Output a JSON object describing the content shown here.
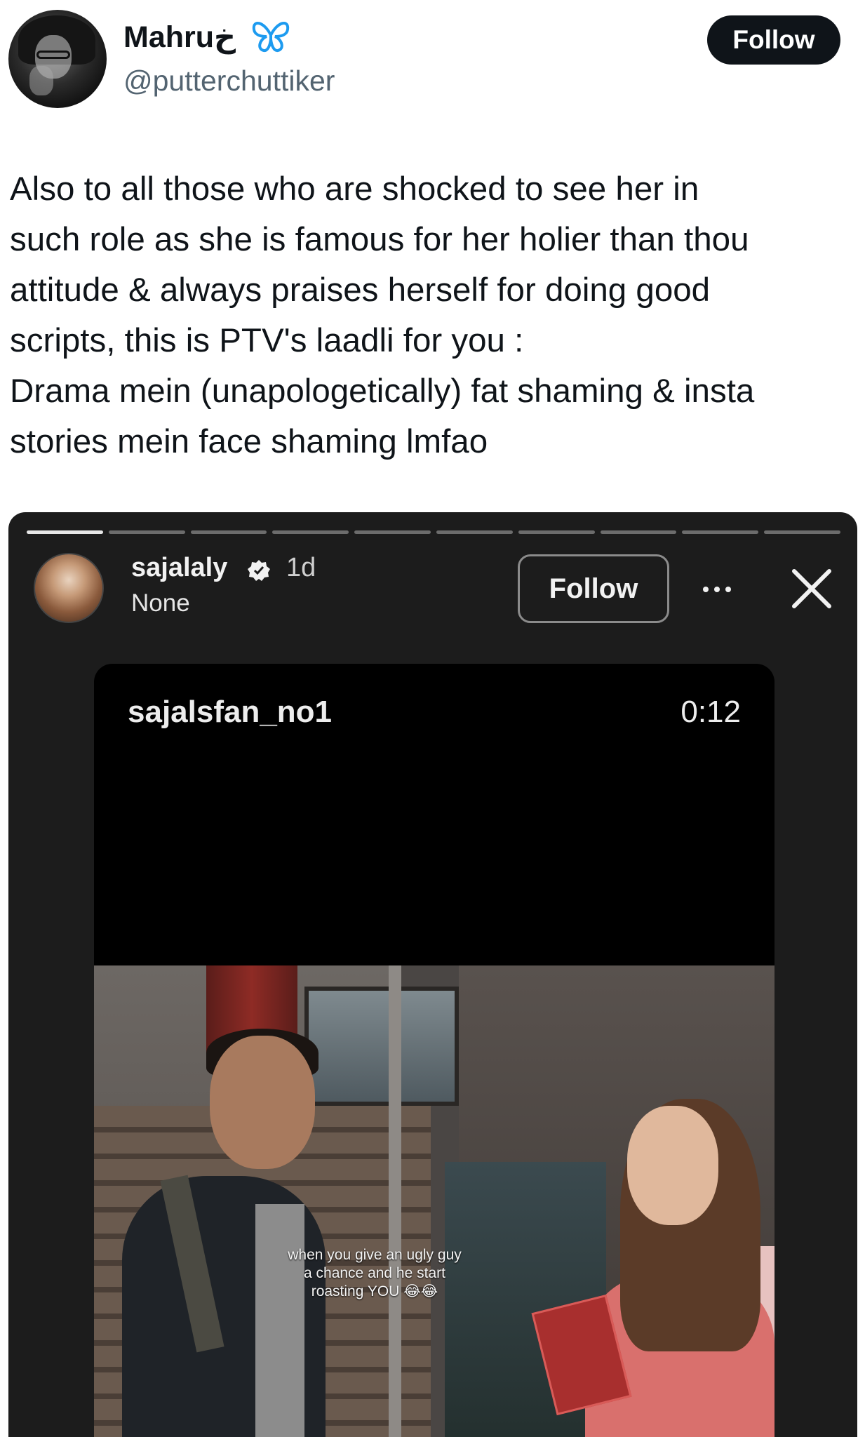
{
  "tweet": {
    "author": {
      "display_name": "Mahruخ",
      "handle": "@putterchuttiker",
      "badge_icon": "butterfly-icon"
    },
    "follow_label": "Follow",
    "text_lines": [
      "Also to all those who are shocked to see her in",
      "such role as she is famous for her holier than thou",
      "attitude & always praises herself for doing good",
      "scripts, this is PTV's laadli for you :",
      "Drama mein (unapologetically) fat shaming & insta",
      "stories mein face shaming lmfao"
    ]
  },
  "story": {
    "segments": 10,
    "segments_done": 1,
    "username": "sajalaly",
    "verified_icon": "verified-badge-icon",
    "time": "1d",
    "subtitle": "None",
    "follow_label": "Follow",
    "more_icon": "more-dots-icon",
    "close_icon": "close-icon",
    "reel": {
      "username": "sajalsfan_no1",
      "timer": "0:12",
      "caption_lines": [
        "when you give an ugly guy",
        "a chance and he start",
        "roasting YOU 😂😂"
      ]
    }
  },
  "colors": {
    "follow_bg": "#0f1419",
    "handle": "#536471",
    "story_bg": "#1c1c1c",
    "butterfly": "#1d9bf0"
  }
}
